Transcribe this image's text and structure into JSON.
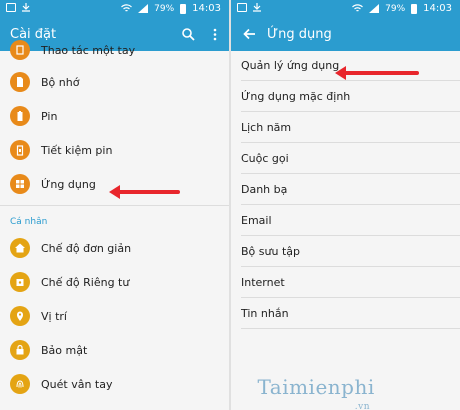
{
  "left": {
    "status_time": "14:03",
    "battery": "79%",
    "title": "Cài đặt",
    "items_top": [
      {
        "label": "Thao tác một tay",
        "icon": "hand-icon"
      },
      {
        "label": "Bộ nhớ",
        "icon": "storage-icon"
      },
      {
        "label": "Pin",
        "icon": "battery-icon"
      },
      {
        "label": "Tiết kiệm pin",
        "icon": "battery-saver-icon"
      },
      {
        "label": "Ứng dụng",
        "icon": "apps-icon"
      }
    ],
    "section": "Cá nhân",
    "items_personal": [
      {
        "label": "Chế độ đơn giản",
        "icon": "home-icon"
      },
      {
        "label": "Chế độ Riêng tư",
        "icon": "private-lock-icon"
      },
      {
        "label": "Vị trí",
        "icon": "location-pin-icon"
      },
      {
        "label": "Bảo mật",
        "icon": "lock-icon"
      },
      {
        "label": "Quét vân tay",
        "icon": "fingerprint-icon"
      }
    ]
  },
  "right": {
    "status_time": "14:03",
    "battery": "79%",
    "title": "Ứng dụng",
    "items": [
      "Quản lý ứng dụng",
      "Ứng dụng mặc định",
      "Lịch năm",
      "Cuộc gọi",
      "Danh bạ",
      "Email",
      "Bộ sưu tập",
      "Internet",
      "Tin nhắn"
    ]
  },
  "watermark": "Taimienphi",
  "watermark_sub": ".vn",
  "colors": {
    "accent": "#2b9ccf",
    "icon_orange": "#e88a1a",
    "arrow_red": "#e8262c"
  }
}
